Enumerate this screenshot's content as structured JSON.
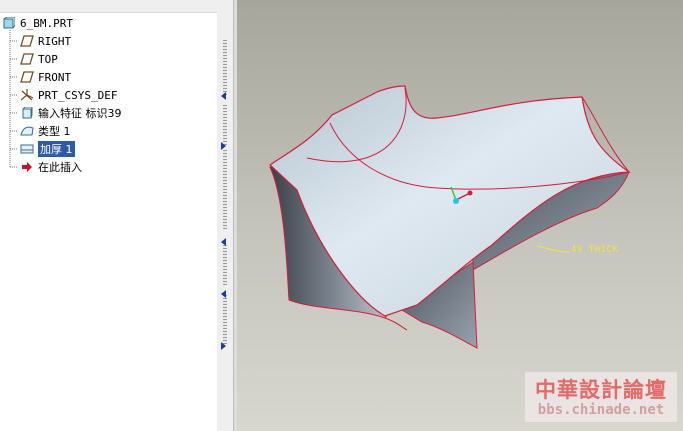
{
  "tree": {
    "items": [
      {
        "label": "6_BM.PRT",
        "icon": "part-icon"
      },
      {
        "label": "RIGHT",
        "icon": "datum-plane-icon"
      },
      {
        "label": "TOP",
        "icon": "datum-plane-icon"
      },
      {
        "label": "FRONT",
        "icon": "datum-plane-icon"
      },
      {
        "label": "PRT_CSYS_DEF",
        "icon": "csys-icon"
      },
      {
        "label": "输入特征 标识39",
        "icon": "import-feature-icon"
      },
      {
        "label": "类型 1",
        "icon": "surface-icon"
      },
      {
        "label": "加厚 1",
        "icon": "thicken-icon",
        "selected": true
      },
      {
        "label": "在此插入",
        "icon": "insert-here-icon"
      }
    ]
  },
  "viewport": {
    "dimension_label": "49 THICK"
  },
  "watermark": {
    "title": "中華設計論壇",
    "url": "bbs.chinade.net"
  },
  "colors": {
    "selection": "#2f5aa8",
    "edge": "#d0203c",
    "dimension": "#f2e53c",
    "background": "#c5c5bd"
  }
}
